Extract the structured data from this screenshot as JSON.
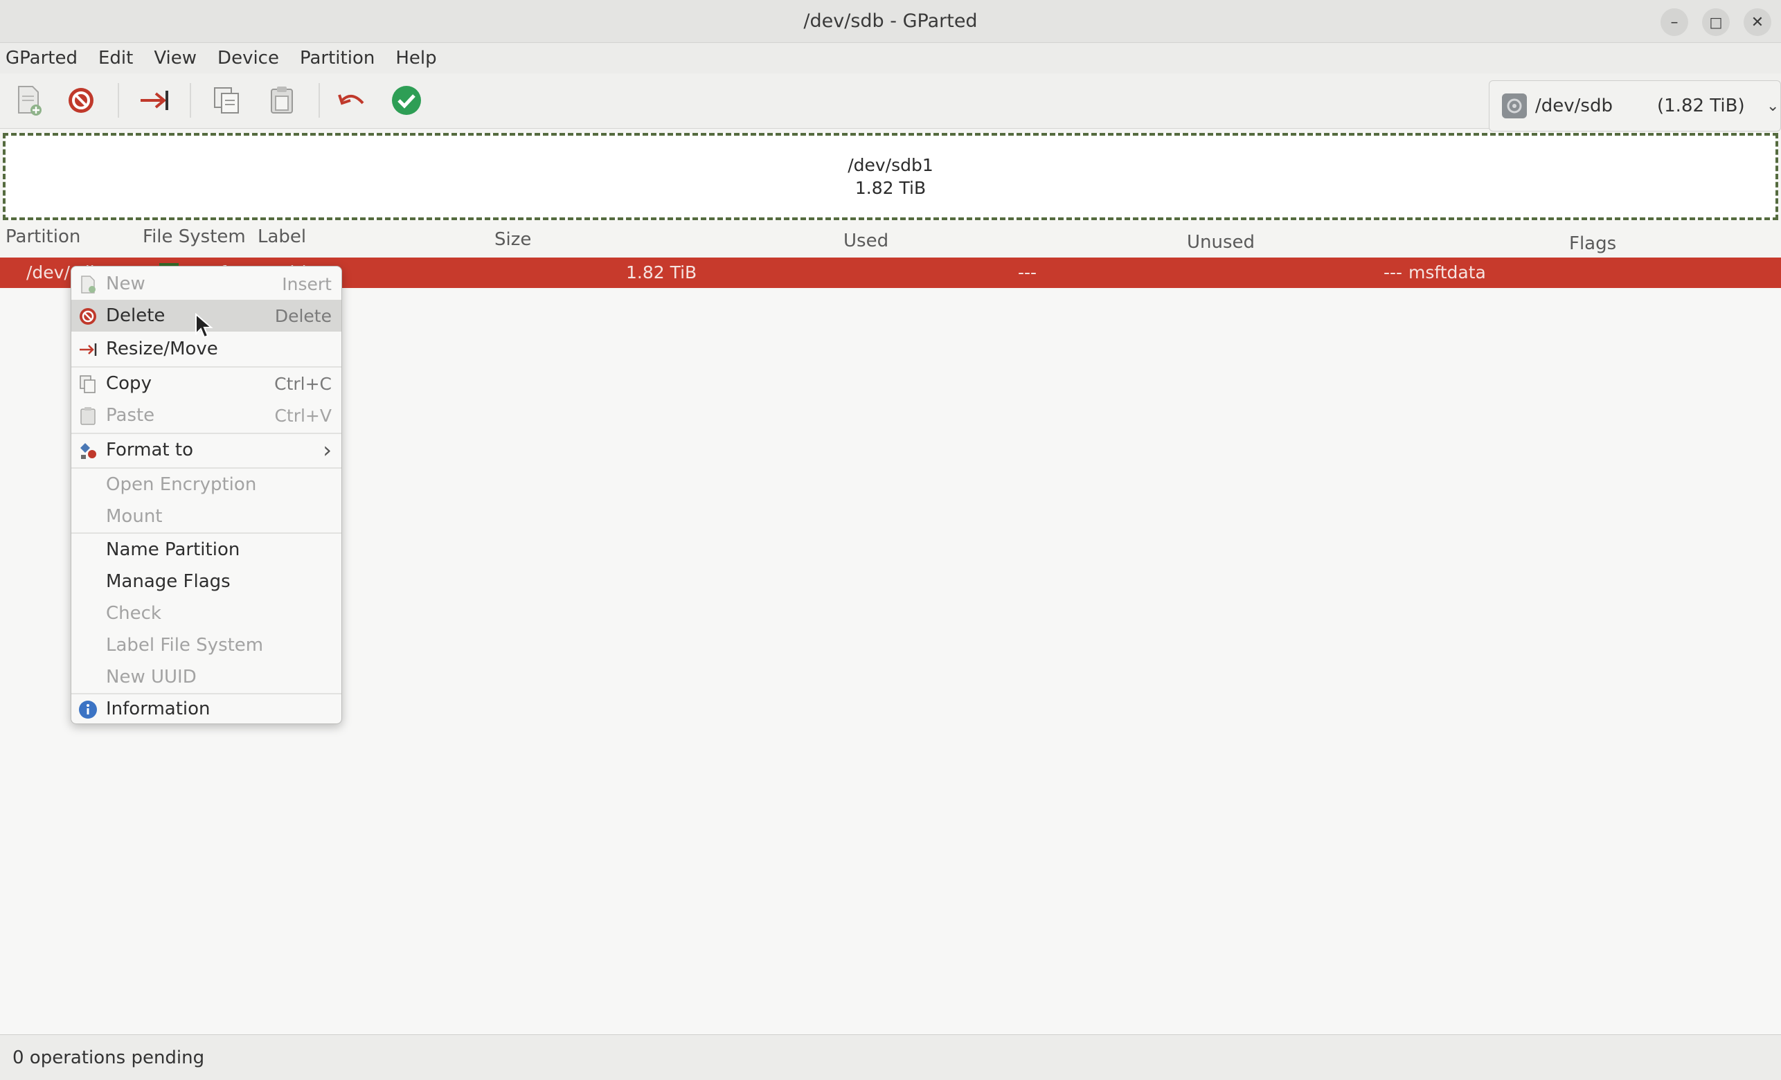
{
  "window": {
    "title": "/dev/sdb - GParted"
  },
  "menubar": {
    "items": [
      "GParted",
      "Edit",
      "View",
      "Device",
      "Partition",
      "Help"
    ]
  },
  "device": {
    "name": "/dev/sdb",
    "size": "(1.82 TiB)"
  },
  "graph": {
    "name": "/dev/sdb1",
    "size": "1.82 TiB"
  },
  "columns": [
    "Partition",
    "File System",
    "Label",
    "Size",
    "Used",
    "Unused",
    "Flags"
  ],
  "row": {
    "partition": "/dev/sdb1",
    "filesystem": "exfat",
    "label": "extdrive",
    "size": "1.82 TiB",
    "used": "---",
    "unused": "---",
    "flags": "msftdata",
    "colors": {
      "row_bg": "#c73a2c",
      "fs_swatch": "#356b2a"
    }
  },
  "context_menu": {
    "items": [
      {
        "label": "New",
        "accel": "Insert"
      },
      {
        "label": "Delete",
        "accel": "Delete"
      },
      {
        "label": "Resize/Move",
        "accel": ""
      },
      {
        "label": "Copy",
        "accel": "Ctrl+C"
      },
      {
        "label": "Paste",
        "accel": "Ctrl+V"
      },
      {
        "label": "Format to",
        "accel": "›"
      },
      {
        "label": "Open Encryption",
        "accel": ""
      },
      {
        "label": "Mount",
        "accel": ""
      },
      {
        "label": "Name Partition",
        "accel": ""
      },
      {
        "label": "Manage Flags",
        "accel": ""
      },
      {
        "label": "Check",
        "accel": ""
      },
      {
        "label": "Label File System",
        "accel": ""
      },
      {
        "label": "New UUID",
        "accel": ""
      },
      {
        "label": "Information",
        "accel": ""
      }
    ]
  },
  "status": {
    "text": "0 operations pending"
  }
}
